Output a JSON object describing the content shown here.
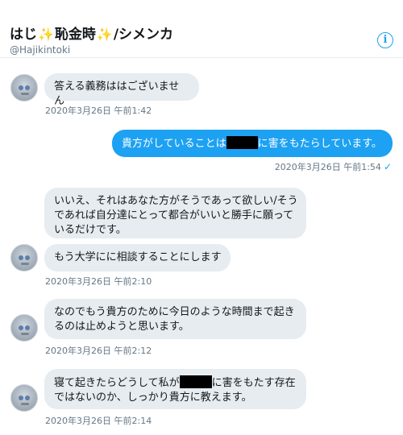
{
  "header": {
    "name_part1": "はじ",
    "name_part2": "恥金時",
    "name_part3": "/シメンカ",
    "sparkle_glyph": "✨",
    "handle": "@Hajikintoki",
    "info_icon": "info-icon"
  },
  "messages": [
    {
      "id": "m1",
      "direction": "received",
      "text": "答える義務ははございません"
    },
    {
      "id": "m1_time",
      "text": "2020年3月26日 午前1:42"
    },
    {
      "id": "m2",
      "direction": "sent",
      "text_before": "貴方がしていることは",
      "text_after": "に害をもたらしています。"
    },
    {
      "id": "m2_time",
      "text": "2020年3月26日 午前1:54"
    },
    {
      "id": "m3",
      "direction": "received",
      "lines": [
        "いいえ、それはあなた方がそうであって欲しい/そう",
        "であれば自分達にとって都合がいいと勝手に願って",
        "いるだけです。"
      ]
    },
    {
      "id": "m4",
      "direction": "received",
      "text": "もう大学にに相談することにします"
    },
    {
      "id": "m4_time",
      "text": "2020年3月26日 午前2:10"
    },
    {
      "id": "m5",
      "direction": "received",
      "lines": [
        "なのでもう貴方のために今日のような時間まで起き",
        "るのは止めようと思います。"
      ]
    },
    {
      "id": "m5_time",
      "text": "2020年3月26日 午前2:12"
    },
    {
      "id": "m6",
      "direction": "received",
      "line1_before": "寝て起きたらどうして私が",
      "line1_after": "に害をもたす存在",
      "line2": "ではないのか、しっかり貴方に教えます。"
    },
    {
      "id": "m6_time",
      "text": "2020年3月26日 午前2:14"
    }
  ],
  "read_check": "✓",
  "colors": {
    "accent": "#1da1f2",
    "received_bubble": "#e6ecf0",
    "text": "#14171a",
    "muted": "#657786"
  }
}
